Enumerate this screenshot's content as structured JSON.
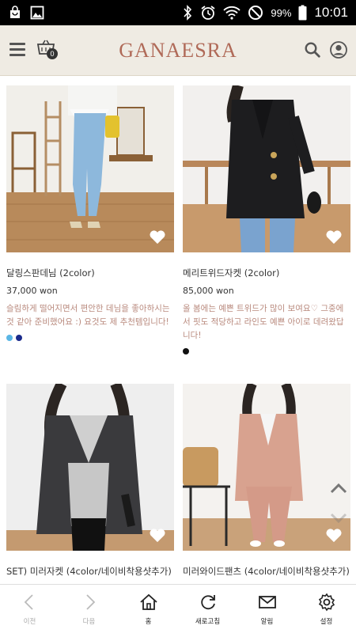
{
  "status_bar": {
    "battery": "99%",
    "time": "10:01"
  },
  "header": {
    "brand": "GANAESRA",
    "cart_count": "0"
  },
  "products": [
    {
      "name": "달링스판데님 (2color)",
      "price": "37,000 won",
      "description": "슬림하게 떨어지면서 편안한 데님을 좋아하시는 것 같아 준비했어요 :) 요것도 제 추천템입니다!",
      "colors": [
        "#5bb6e5",
        "#1a2a8c"
      ]
    },
    {
      "name": "메리트위드자켓 (2color)",
      "price": "85,000 won",
      "description": "올 봄에는 예쁜 트위드가 많이 보여요♡ 그중에서 핏도 적당하고 라인도 예쁜 아이로 데려왔답니다!",
      "colors": [
        "#111111"
      ]
    },
    {
      "name": "SET) 미러자켓 (4color/네이비착용샷추가)",
      "price": "",
      "description": "",
      "colors": []
    },
    {
      "name": "미러와이드팬츠 (4color/네이비착용샷추가)",
      "price": "",
      "description": "",
      "colors": []
    }
  ],
  "bottom_nav": [
    {
      "label": "이전",
      "icon": "back-arrow-icon",
      "enabled": false
    },
    {
      "label": "다음",
      "icon": "forward-arrow-icon",
      "enabled": false
    },
    {
      "label": "홈",
      "icon": "home-icon",
      "enabled": true
    },
    {
      "label": "새로고침",
      "icon": "refresh-icon",
      "enabled": true
    },
    {
      "label": "알림",
      "icon": "mail-icon",
      "enabled": true
    },
    {
      "label": "설정",
      "icon": "settings-gear-icon",
      "enabled": true
    }
  ]
}
